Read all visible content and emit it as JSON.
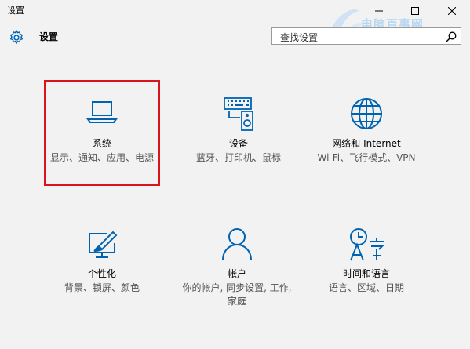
{
  "window": {
    "title": "设置",
    "minimize_glyph": "─",
    "maximize_glyph": "□",
    "close_glyph": "✕"
  },
  "header": {
    "title": "设置",
    "icon": "gear-icon"
  },
  "search": {
    "placeholder": "查找设置",
    "icon": "search-icon"
  },
  "watermark": {
    "text": "电脑百事网",
    "sub": "www.PC841.COM"
  },
  "colors": {
    "accent": "#0063b1",
    "highlight": "#d9141d",
    "background": "#f2f2f2"
  },
  "tiles": [
    {
      "title": "系统",
      "desc": "显示、通知、应用、电源",
      "icon": "laptop-icon"
    },
    {
      "title": "设备",
      "desc": "蓝牙、打印机、鼠标",
      "icon": "keyboard-speaker-icon"
    },
    {
      "title": "网络和 Internet",
      "desc": "Wi-Fi、飞行模式、VPN",
      "icon": "globe-icon"
    },
    {
      "title": "个性化",
      "desc": "背景、锁屏、颜色",
      "icon": "paint-monitor-icon"
    },
    {
      "title": "帐户",
      "desc": "你的帐户, 同步设置, 工作, 家庭",
      "icon": "person-icon"
    },
    {
      "title": "时间和语言",
      "desc": "语言、区域、日期",
      "icon": "clock-language-icon"
    }
  ]
}
